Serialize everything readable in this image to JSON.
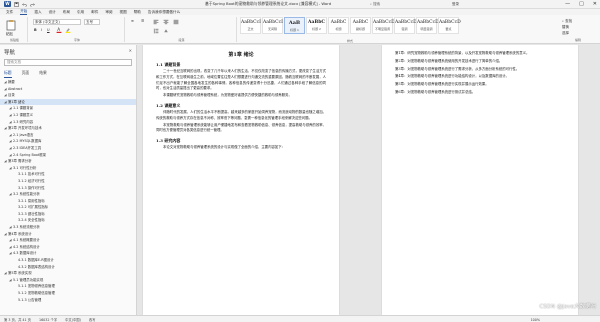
{
  "window": {
    "title": "基于Spring Boot的宠物救助与领养管理系统论文.docx [兼容模式] - Word",
    "search_hint": "搜索",
    "user": "登录",
    "controls": [
      "—",
      "□",
      "✕"
    ]
  },
  "menu": {
    "tabs": [
      "文件",
      "开始",
      "插入",
      "设计",
      "布局",
      "引用",
      "邮件",
      "审阅",
      "视图",
      "帮助",
      "告诉我你想要做什么"
    ],
    "active_index": 1
  },
  "ribbon": {
    "groups": [
      {
        "label": "剪贴板",
        "buttons": [
          "粘贴"
        ]
      },
      {
        "label": "字体",
        "buttons": [
          "宋体 (中文正文)",
          "五号",
          "B",
          "I",
          "U"
        ]
      },
      {
        "label": "段落",
        "buttons": [
          "≡",
          "☰"
        ]
      },
      {
        "label": "样式",
        "buttons": []
      },
      {
        "label": "编辑",
        "buttons": [
          "查找",
          "替换",
          "选择"
        ]
      }
    ],
    "styles": [
      {
        "preview": "AaBbCcI",
        "name": "正文"
      },
      {
        "preview": "AaBbCcI",
        "name": "无间隔"
      },
      {
        "preview": "AaB",
        "name": "标题 1"
      },
      {
        "preview": "AaBbC",
        "name": "标题 2"
      },
      {
        "preview": "AaBbC",
        "name": "标题"
      },
      {
        "preview": "AaBbC",
        "name": "副标题"
      },
      {
        "preview": "AaBbCcD",
        "name": "不明显强调"
      },
      {
        "preview": "AaBbCcD",
        "name": "强调"
      },
      {
        "preview": "AaBbCcD",
        "name": "明显强调"
      },
      {
        "preview": "AaBbCcD",
        "name": "要点"
      }
    ],
    "selected_style_index": 2
  },
  "nav": {
    "title": "导航",
    "search_placeholder": "搜索文档",
    "tabs": [
      "标题",
      "页面",
      "结果"
    ],
    "items": [
      {
        "label": "摘要",
        "level": 1
      },
      {
        "label": "Abstract",
        "level": 1
      },
      {
        "label": "目录",
        "level": 1
      },
      {
        "label": "第1章 绪论",
        "level": 1,
        "selected": true
      },
      {
        "label": "1.1 课题背景",
        "level": 2
      },
      {
        "label": "1.2 课题意义",
        "level": 2
      },
      {
        "label": "1.3 研究内容",
        "level": 2
      },
      {
        "label": "第2章 开发环境与技术",
        "level": 1
      },
      {
        "label": "2.1 Java语言",
        "level": 2
      },
      {
        "label": "2.2 MYSQL数据库",
        "level": 2
      },
      {
        "label": "2.3 IDEA开发工具",
        "level": 2
      },
      {
        "label": "2.4 Spring Boot框架",
        "level": 2
      },
      {
        "label": "第3章 需求分析",
        "level": 1
      },
      {
        "label": "3.1 可行性分析",
        "level": 2
      },
      {
        "label": "3.1.1 技术可行性",
        "level": 3
      },
      {
        "label": "3.1.2 经济可行性",
        "level": 3
      },
      {
        "label": "3.1.3 操作可行性",
        "level": 3
      },
      {
        "label": "3.2 系统性能分析",
        "level": 2
      },
      {
        "label": "3.2.1 易用性指标",
        "level": 3
      },
      {
        "label": "3.2.2 可扩展性指标",
        "level": 3
      },
      {
        "label": "3.2.3 健壮性指标",
        "level": 3
      },
      {
        "label": "3.2.4 安全性指标",
        "level": 3
      },
      {
        "label": "3.3 系统流程分析",
        "level": 2
      },
      {
        "label": "第4章 系统设计",
        "level": 1
      },
      {
        "label": "4.1 系统概要设计",
        "level": 2
      },
      {
        "label": "4.2 系统结构设计",
        "level": 2
      },
      {
        "label": "4.3 数据库设计",
        "level": 2
      },
      {
        "label": "4.3.1 数据库E-R图设计",
        "level": 3
      },
      {
        "label": "4.3.2 数据库表结构设计",
        "level": 3
      },
      {
        "label": "第5章 系统实现",
        "level": 1
      },
      {
        "label": "5.1 管理员功能实现",
        "level": 2
      },
      {
        "label": "5.1.1 宠物领养信息管理",
        "level": 3
      },
      {
        "label": "5.1.2 宠物救助信息管理",
        "level": 3
      },
      {
        "label": "5.1.3 公告管理",
        "level": 3
      }
    ]
  },
  "doc": {
    "chapter_title": "第1章 绪论",
    "sections": [
      {
        "heading": "1.1 课题背景",
        "paragraphs": [
          "二十一世纪互联网的出现，改变了几千年以来人们的生活，不仅仅改变了信息的传播方式，更改变了生活方式和工作方式，在互联网诞生之前，地域位置往往是人们想要进行沟通交流的重要原因。随着互联网的不断发展，人们足不出户就能了解全国各地发生的各种事情。各种信息的传递变得十分迅捷，人们通过各种手段了解信息的同时，也对生活质量提出了更高的要求。",
          "本课题研究宠物救助与领养管理系统，为宠物爱好者提供方便快捷的救助与领养服务。"
        ]
      },
      {
        "heading": "1.2 课题意义",
        "paragraphs": [
          "伴随时代的发展，人们的生活水平不断提高，越来越多的家庭开始饲养宠物，而流浪动物的数量也随之增加。传统的救助与领养方式存在信息不对称、效率低下等问题，急需一种信息化的管理手段来解决这些问题。",
          "本宠物救助与领养管理系统能够让用户便捷地发布和查看宠物救助信息、领养信息，提高救助与领养的效率，同时也方便管理员对各类信息进行统一管理。"
        ]
      },
      {
        "heading": "1.3 研究内容",
        "paragraphs": [
          "本论文对宠物救助与领养管理系统的设计与实现做了全面的介绍，主要内容如下："
        ]
      }
    ],
    "page2_items": [
      "第1章：研究宠物救助与领养管理系统的背景，以及开发宠物救助与领养管理系统的意义。",
      "第2章：对宠物救助与领养管理系统使用的开发技术进行了简单的介绍。",
      "第3章：对宠物救助与领养管理系统进行了需求分析，从多方面分析系统的可行性。",
      "第4章：对宠物救助与领养管理系统进行功能结构设计，以及数据库的设计。",
      "第5章：对宠物救助与领养管理系统进行实现并展示运行效果。",
      "第6章：对宠物救助与领养管理系统进行测试并总结。"
    ]
  },
  "status": {
    "page": "第 3 页，共 41 页",
    "words": "16032 个字",
    "language": "中文(中国)",
    "mode": "改写",
    "zoom": "100%"
  },
  "watermark": "CSDN @Java大数据吧"
}
